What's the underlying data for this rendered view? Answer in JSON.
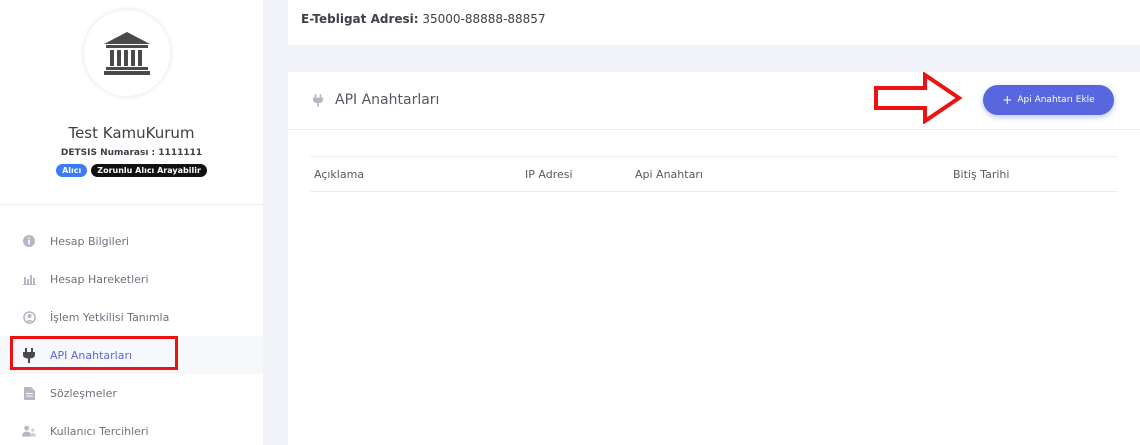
{
  "sidebar": {
    "org_name": "Test KamuKurum",
    "detsis": "DETSIS Numarası : 1111111",
    "badges": [
      "Alıcı",
      "Zorunlu Alıcı Arayabilir"
    ],
    "items": [
      {
        "label": "Hesap Bilgileri",
        "icon": "info-icon"
      },
      {
        "label": "Hesap Hareketleri",
        "icon": "bar-chart-icon"
      },
      {
        "label": "İşlem Yetkilisi Tanımla",
        "icon": "user-circle-icon"
      },
      {
        "label": "API Anahtarları",
        "icon": "plug-icon",
        "active": true
      },
      {
        "label": "Sözleşmeler",
        "icon": "document-icon"
      },
      {
        "label": "Kullanıcı Tercihleri",
        "icon": "users-icon"
      }
    ]
  },
  "top_card": {
    "label": "E-Tebligat Adresi:",
    "value": "35000-88888-88857"
  },
  "main_card": {
    "title": "API Anahtarları",
    "add_button": "Api Anahtarı Ekle",
    "columns": [
      "Açıklama",
      "IP Adresi",
      "Api Anahtarı",
      "Bitiş Tarihi"
    ]
  },
  "colors": {
    "accent": "#5867dd",
    "highlight": "#ee1111",
    "badge_blue": "#3d7bf6"
  }
}
